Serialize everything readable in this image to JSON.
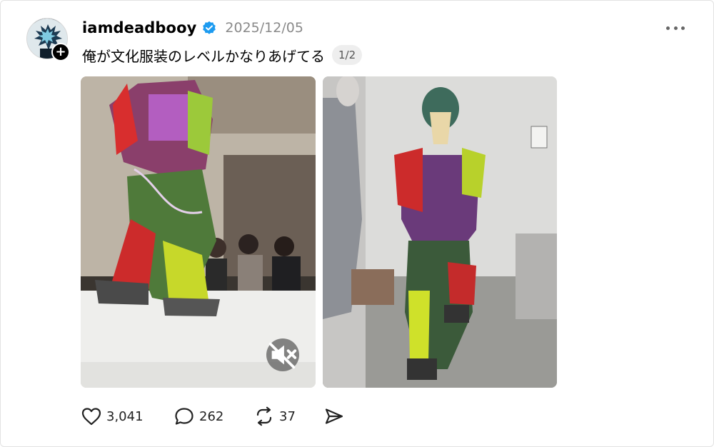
{
  "post": {
    "username": "iamdeadbooy",
    "timestamp": "2025/12/05",
    "caption": "俺が文化服装のレベルかなりあげてる",
    "page_indicator": "1/2",
    "verified": true
  },
  "media": [
    {
      "kind": "video",
      "muted": true
    },
    {
      "kind": "image"
    }
  ],
  "actions": {
    "likes": "3,041",
    "replies": "262",
    "reposts": "37"
  },
  "colors": {
    "verified_blue": "#1d9bf0",
    "timestamp_gray": "#8a8a8a",
    "icon_dark": "#222222"
  },
  "icons": [
    "more-icon",
    "verified-icon",
    "follow-plus-icon",
    "mute-icon",
    "heart-icon",
    "reply-icon",
    "repost-icon",
    "share-icon"
  ]
}
